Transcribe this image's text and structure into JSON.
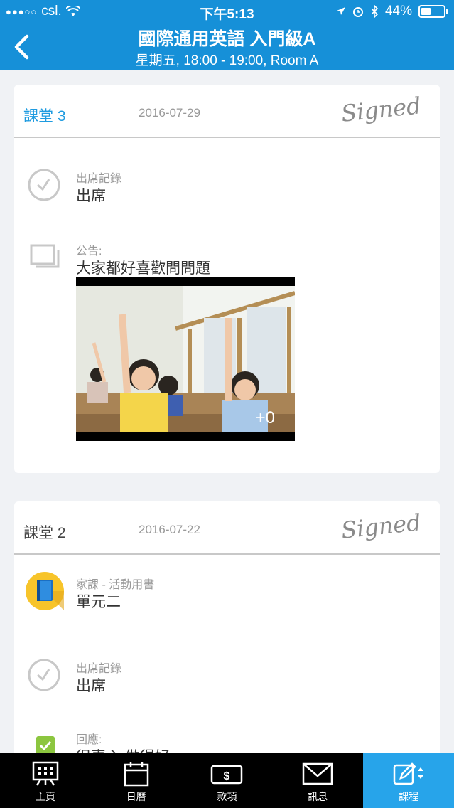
{
  "status_bar": {
    "carrier": "csl.",
    "time": "下午5:13",
    "battery": "44%",
    "battery_level": 0.44
  },
  "header": {
    "title": "國際通用英語 入門級A",
    "subtitle": "星期五, 18:00 - 19:00, Room A"
  },
  "lessons": [
    {
      "name": "課堂 3",
      "date": "2016-07-29",
      "signed": "Signed",
      "attendance": {
        "label": "出席記錄",
        "value": "出席"
      },
      "announcement": {
        "label": "公告:",
        "value": "大家都好喜歡問問題",
        "photo_count": "+0"
      }
    },
    {
      "name": "課堂 2",
      "date": "2016-07-22",
      "signed": "Signed",
      "homework": {
        "label": "家課 - 活動用書",
        "value": "單元二"
      },
      "attendance": {
        "label": "出席記錄",
        "value": "出席"
      },
      "feedback": {
        "label": "回應:",
        "value": "很專心 做得好"
      }
    }
  ],
  "tabs": [
    {
      "label": "主頁",
      "icon": "whiteboard-icon"
    },
    {
      "label": "日曆",
      "icon": "calendar-icon"
    },
    {
      "label": "款項",
      "icon": "payment-icon"
    },
    {
      "label": "訊息",
      "icon": "mail-icon"
    },
    {
      "label": "課程",
      "icon": "edit-course-icon"
    }
  ],
  "colors": {
    "header": "#1690d8",
    "active_tab": "#27a4ea",
    "accent": "#1e9be0"
  }
}
